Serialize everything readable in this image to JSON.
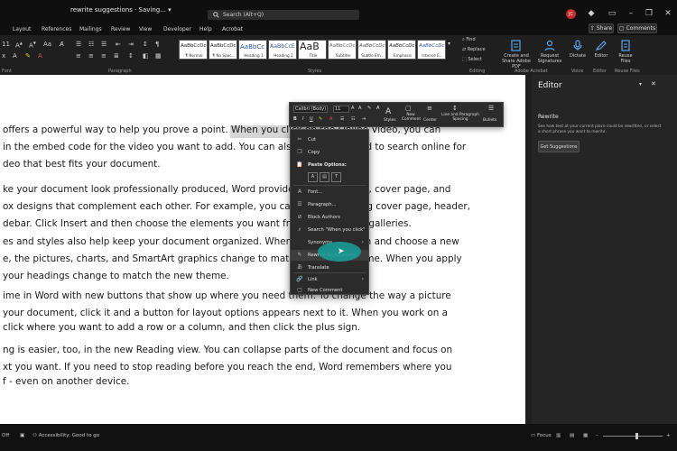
{
  "titlebar": {
    "doc_title": "rewrite suggestions  ·  Saving... ▾",
    "search_placeholder": "Search (Alt+Q)",
    "avatar_initials": "JC",
    "window_controls": [
      "minimize",
      "restore",
      "close"
    ]
  },
  "menubar": {
    "items": [
      "Layout",
      "References",
      "Mailings",
      "Review",
      "View",
      "Developer",
      "Help",
      "Acrobat"
    ],
    "share_label": "Share",
    "comments_label": "Comments"
  },
  "ribbon": {
    "font_size": "11",
    "styles": [
      {
        "sample": "AaBbCcDc",
        "name": "¶ Normal"
      },
      {
        "sample": "AaBbCcDc",
        "name": "¶ No Spac..."
      },
      {
        "sample": "AaBbCc",
        "name": "Heading 1"
      },
      {
        "sample": "AaBbCcE",
        "name": "Heading 2"
      },
      {
        "sample": "AaB",
        "name": "Title"
      },
      {
        "sample": "AaBbCcDc",
        "name": "Subtitle"
      },
      {
        "sample": "AaBbCcDc",
        "name": "Subtle Em..."
      },
      {
        "sample": "AaBbCcDc",
        "name": "Emphasis"
      },
      {
        "sample": "AaBbCcDc",
        "name": "Intense E..."
      }
    ],
    "editing": {
      "find": "Find",
      "replace": "Replace",
      "select": "Select"
    },
    "buttons": [
      {
        "label": "Create and Share Adobe PDF",
        "icon": "pdf-icon"
      },
      {
        "label": "Request Signatures",
        "icon": "signature-icon"
      },
      {
        "label": "Dictate",
        "icon": "microphone-icon"
      },
      {
        "label": "Editor",
        "icon": "editor-icon"
      },
      {
        "label": "Reuse Files",
        "icon": "reuse-files-icon"
      }
    ],
    "group_labels": [
      "Font",
      "Paragraph",
      "Styles",
      "Editing",
      "Adobe Acrobat",
      "Voice",
      "Editor",
      "Reuse Files"
    ]
  },
  "document": {
    "paragraphs": [
      [
        "offers a powerful way to help you prove a point. When you click on the Online Video, you can",
        "in the embed code for the video you want to add. You can also type a keyword to search online for",
        "deo that best fits your document."
      ],
      [
        "ke your document look professionally produced, Word provides header, footer, cover page, and",
        "ox designs that complement each other. For example, you can add a matching cover page, header,",
        "debar. Click Insert and then choose the elements you want from the different galleries."
      ],
      [
        "es and styles also help keep your document organized. When you click Design and choose a new",
        "e, the pictures, charts, and SmartArt graphics change to match your new theme. When you apply",
        " your headings change to match the new theme."
      ],
      [
        "ime in Word with new buttons that show up where you need them. To change the way a picture",
        "your document, click it and a button for layout options appears next to it. When you work on a",
        "click where you want to add a row or a column, and then click the plus sign."
      ],
      [
        "ng is easier, too, in the new Reading view. You can collapse parts of the document and focus on",
        "xt you want. If you need to stop reading before you reach the end, Word remembers where you",
        "f - even on another device."
      ]
    ],
    "selected_text": "When you click on the Online Video"
  },
  "mini_toolbar": {
    "font_name": "Calibri (Body)",
    "font_size": "11",
    "buttons": [
      "Styles",
      "New Comment",
      "Center",
      "Line and Paragraph Spacing",
      "Bullets"
    ]
  },
  "context_menu": {
    "items": [
      {
        "label": "Cut",
        "icon": "scissors-icon"
      },
      {
        "label": "Copy",
        "icon": "copy-icon"
      },
      {
        "label": "Paste Options:",
        "icon": "paste-icon"
      },
      {
        "label": "Font...",
        "icon": "font-icon"
      },
      {
        "label": "Paragraph...",
        "icon": "paragraph-icon"
      },
      {
        "label": "Block Authors",
        "icon": "block-authors-icon"
      },
      {
        "label": "Search \"When you click\"",
        "icon": "search-icon"
      },
      {
        "label": "Synonyms",
        "icon": "",
        "submenu": true
      },
      {
        "label": "Rewrite Suggestions",
        "icon": "rewrite-icon",
        "highlighted": true
      },
      {
        "label": "Translate",
        "icon": "translate-icon"
      },
      {
        "label": "Link",
        "icon": "link-icon",
        "submenu": true
      },
      {
        "label": "New Comment",
        "icon": "comment-icon"
      }
    ]
  },
  "editor_pane": {
    "title": "Editor",
    "section": "Rewrite",
    "description": "See how text at your current place could be rewritten, or select a short phrase you want to rewrite.",
    "button_label": "Get Suggestions"
  },
  "statusbar": {
    "left_text": "Off",
    "accessibility": "Accessibility: Good to go",
    "focus": "Focus"
  },
  "colors": {
    "accent": "#c42b2b",
    "cursor_highlight": "#1a9b96",
    "selection": "#d5d5d5"
  }
}
